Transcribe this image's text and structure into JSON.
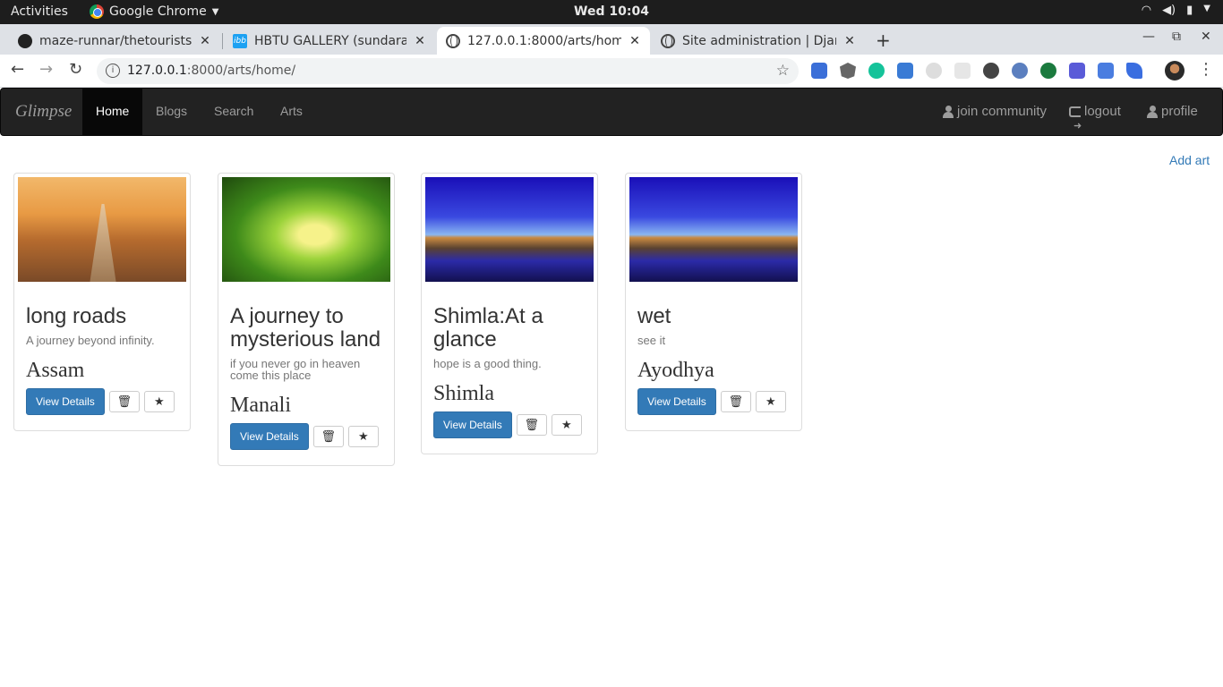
{
  "os": {
    "activities": "Activities",
    "app_name": "Google Chrome",
    "clock": "Wed 10:04"
  },
  "browser": {
    "tabs": [
      {
        "title": "maze-runnar/thetourists",
        "icon": "github-icon"
      },
      {
        "title": "HBTU GALLERY (sundaram",
        "icon": "ibb-icon"
      },
      {
        "title": "127.0.0.1:8000/arts/home",
        "icon": "globe-icon",
        "active": true
      },
      {
        "title": "Site administration | Djan",
        "icon": "globe-icon"
      }
    ],
    "url_host": "127.0.0.1",
    "url_path": ":8000/arts/home/"
  },
  "navbar": {
    "brand": "Glimpse",
    "items": [
      "Home",
      "Blogs",
      "Search",
      "Arts"
    ],
    "active_item": "Home",
    "right": {
      "join": "join community",
      "logout": "logout",
      "profile": "profile"
    }
  },
  "add_art": "Add art",
  "cards": [
    {
      "title": "long roads",
      "description": "A journey beyond infinity.",
      "place": "Assam",
      "image": "road-photo"
    },
    {
      "title": "A journey to mysterious land",
      "description": "if you never go in heaven come this place",
      "place": "Manali",
      "image": "forest-photo"
    },
    {
      "title": "Shimla:At a glance",
      "description": "hope is a good thing.",
      "place": "Shimla",
      "image": "beach-photo"
    },
    {
      "title": "wet",
      "description": "see it",
      "place": "Ayodhya",
      "image": "beach-photo"
    }
  ],
  "buttons": {
    "view_details": "View Details",
    "delete_glyph": "🗑",
    "star_glyph": "★"
  },
  "colors": {
    "navbar_bg": "#222222",
    "primary": "#337ab7",
    "link": "#337ab7"
  }
}
